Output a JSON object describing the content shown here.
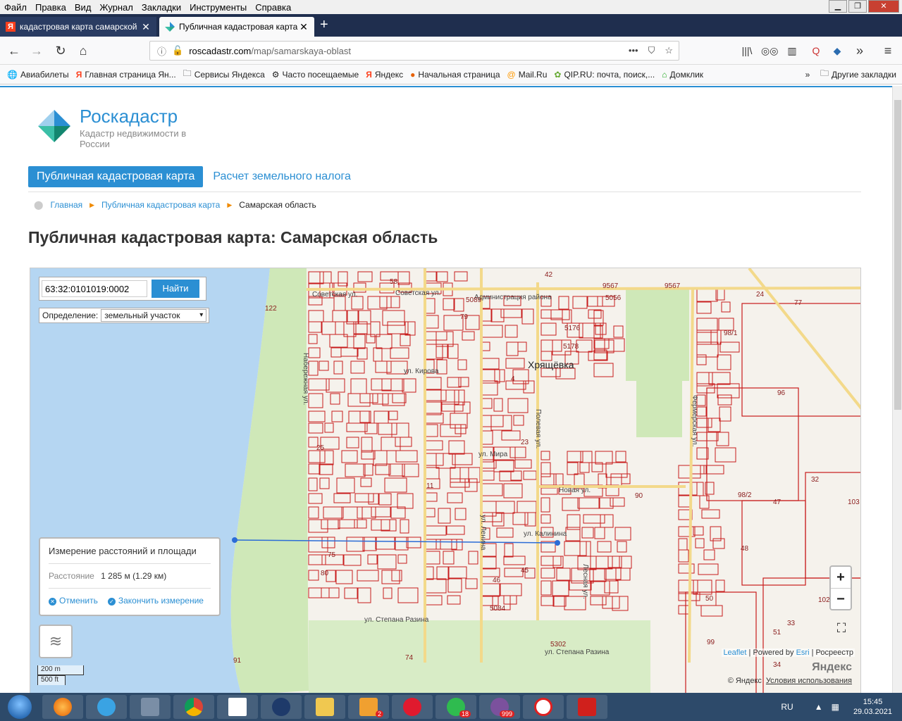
{
  "menubar": {
    "items": [
      "Файл",
      "Правка",
      "Вид",
      "Журнал",
      "Закладки",
      "Инструменты",
      "Справка"
    ]
  },
  "tabs": [
    {
      "title": "кадастровая карта самарской"
    },
    {
      "title": "Публичная кадастровая карта"
    }
  ],
  "nav": {
    "url_host": "roscadastr.com",
    "url_path": "/map/samarskaya-oblast"
  },
  "bookmarks": [
    "Авиабилеты",
    "Главная страница Ян...",
    "Сервисы Яндекса",
    "Часто посещаемые",
    "Яндекс",
    "Начальная страница",
    "Mail.Ru",
    "QIP.RU: почта, поиск,...",
    "Домклик",
    "Другие закладки"
  ],
  "site": {
    "brand": "Роскадастр",
    "brand_sub": "Кадастр недвижимости в России",
    "tab_active": "Публичная кадастровая карта",
    "tab_inactive": "Расчет земельного налога",
    "breadcrumb": [
      "Главная",
      "Публичная кадастровая карта",
      "Самарская область"
    ],
    "title": "Публичная кадастровая карта: Самарская область"
  },
  "map": {
    "search_value": "63:32:0101019:0002",
    "search_button": "Найти",
    "definition_label": "Определение:",
    "definition_value": "земельный участок",
    "measure": {
      "title": "Измерение расстояний и площади",
      "distance_label": "Расстояние",
      "distance_value": "1 285 м (1.29 км)",
      "cancel": "Отменить",
      "finish": "Закончить измерение"
    },
    "scale_m": "200 m",
    "scale_ft": "500 ft",
    "zoom_in": "+",
    "zoom_out": "−",
    "attribution_leaflet": "Leaflet",
    "attribution_mid": " | Powered by ",
    "attribution_esri": "Esri",
    "attribution_end": " | Росреестр",
    "yandex_logo": "Яндекс",
    "yandex_copy": "© Яндекс",
    "yandex_terms": "Условия использования",
    "labels": {
      "place": "Хрящёвка",
      "streets": [
        "Советская ул.",
        "Советская ул.",
        "ул. Кирова",
        "Набережная ул.",
        "Полевая ул.",
        "ул. Мира",
        "Новая ул.",
        "ул. Калинина",
        "Фермерская ул.",
        "ул. Степана Разина",
        "ул. Степана Разина",
        "ул. Ленина",
        "Лесная ул.",
        "Администрация района"
      ],
      "numbers": [
        "58",
        "42",
        "9567",
        "9567",
        "5056",
        "5089",
        "79",
        "5176",
        "5178",
        "77",
        "98/1",
        "122",
        "96",
        "4",
        "25",
        "23",
        "11",
        "32",
        "103",
        "98/2",
        "47",
        "90",
        "75",
        "48",
        "80",
        "45",
        "46",
        "5084",
        "50",
        "102",
        "99",
        "51",
        "33",
        "5302",
        "74",
        "91",
        "34",
        "24"
      ]
    }
  },
  "taskbar": {
    "lang": "RU",
    "time": "15:45",
    "date": "29.03.2021",
    "badges": [
      "18",
      "999",
      "2"
    ]
  }
}
